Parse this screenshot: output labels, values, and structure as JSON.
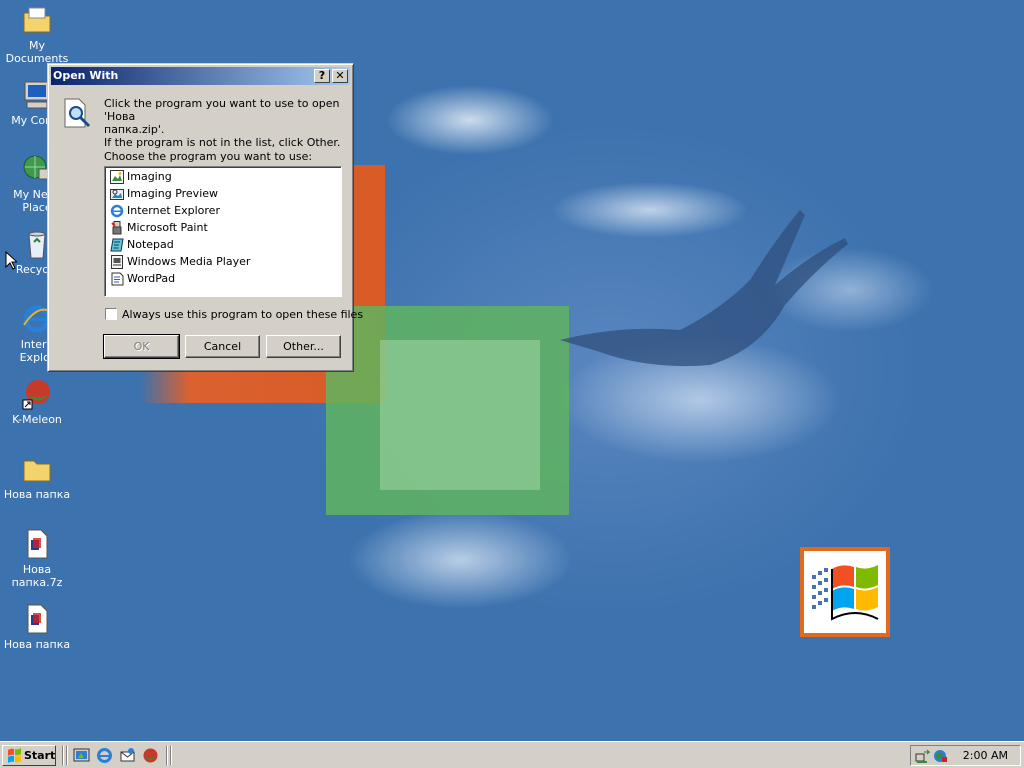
{
  "desktop": {
    "icons": [
      {
        "label": "My Documents"
      },
      {
        "label": "My Comp"
      },
      {
        "label_line1": "My Netw",
        "label_line2": "Place"
      },
      {
        "label": "Recycle"
      },
      {
        "label_line1": "Intern",
        "label_line2": "Explor"
      },
      {
        "label": "K-Meleon"
      },
      {
        "label": "Нова папка"
      },
      {
        "label_line1": "Нова",
        "label_line2": "папка.7z"
      },
      {
        "label": "Нова папка"
      }
    ]
  },
  "dialog": {
    "title": "Open With",
    "help_symbol": "?",
    "close_symbol": "✕",
    "intro_line1": "Click the program you want to use to open 'Нова",
    "intro_line2": "папка.zip'.",
    "intro_line3": "If the program is not in the list, click Other.",
    "choose_label": "Choose the program you want to use:",
    "programs": [
      {
        "label": "Imaging",
        "icon": "imaging-icon"
      },
      {
        "label": "Imaging Preview",
        "icon": "imaging-preview-icon"
      },
      {
        "label": "Internet Explorer",
        "icon": "internet-explorer-icon"
      },
      {
        "label": "Microsoft Paint",
        "icon": "paint-icon"
      },
      {
        "label": "Notepad",
        "icon": "notepad-icon"
      },
      {
        "label": "Windows Media Player",
        "icon": "media-player-icon"
      },
      {
        "label": "WordPad",
        "icon": "wordpad-icon"
      }
    ],
    "always_use_label": "Always use this program to open these files",
    "always_use_checked": false,
    "ok_label": "OK",
    "cancel_label": "Cancel",
    "other_label": "Other..."
  },
  "taskbar": {
    "start_label": "Start",
    "clock": "2:00 AM"
  },
  "colors": {
    "desktop": "#3a6ea5",
    "title_start": "#0a246a",
    "title_end": "#a6caf0",
    "face": "#d4d0c8"
  }
}
